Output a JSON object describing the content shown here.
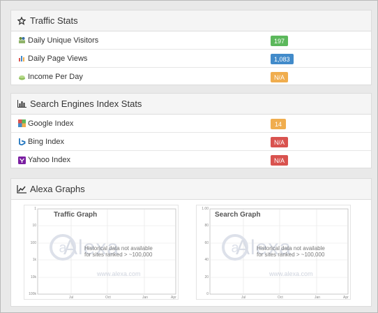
{
  "traffic": {
    "title": "Traffic Stats",
    "rows": [
      {
        "label": "Daily Unique Visitors",
        "value": "197",
        "color": "#5cb85c",
        "icon": "visitors-icon"
      },
      {
        "label": "Daily Page Views",
        "value": "1,083",
        "color": "#428bca",
        "icon": "bar-chart-icon"
      },
      {
        "label": "Income Per Day",
        "value": "N/A",
        "color": "#f0ad4e",
        "icon": "money-icon"
      }
    ]
  },
  "search": {
    "title": "Search Engines Index Stats",
    "rows": [
      {
        "label": "Google Index",
        "value": "14",
        "color": "#f0ad4e",
        "icon": "google-icon"
      },
      {
        "label": "Bing Index",
        "value": "N/A",
        "color": "#d9534f",
        "icon": "bing-icon"
      },
      {
        "label": "Yahoo Index",
        "value": "N/A",
        "color": "#d9534f",
        "icon": "yahoo-icon"
      }
    ]
  },
  "alexa": {
    "title": "Alexa Graphs",
    "traffic_graph": {
      "title": "Traffic Graph",
      "note_line1": "Historical data not available",
      "note_line2": "for sites ranked > ~100,000",
      "watermark": "Alexa",
      "watermark_url": "www.alexa.com",
      "y_ticks": [
        "1",
        "10",
        "100",
        "1k",
        "10k",
        "100k"
      ],
      "x_ticks": [
        "Jul",
        "Oct",
        "Jan",
        "Apr"
      ]
    },
    "search_graph": {
      "title": "Search Graph",
      "note_line1": "Historical data not available",
      "note_line2": "for sites ranked > ~100,000",
      "watermark": "Alexa",
      "watermark_url": "www.alexa.com",
      "y_ticks": [
        "1.00",
        "80",
        "60",
        "40",
        "20",
        "0"
      ],
      "x_ticks": [
        "Jul",
        "Oct",
        "Jan",
        "Apr"
      ]
    }
  }
}
